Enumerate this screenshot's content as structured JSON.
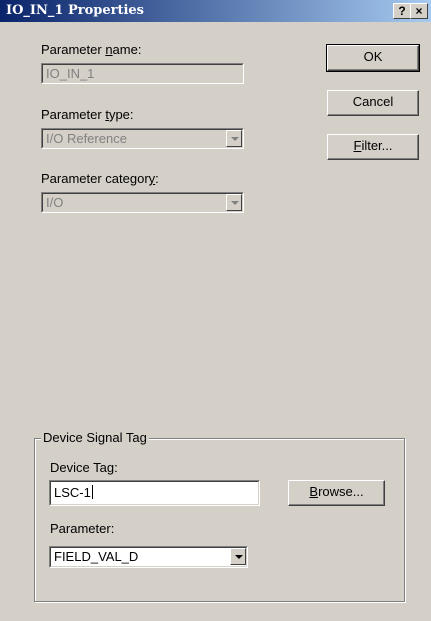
{
  "window": {
    "title": "IO_IN_1 Properties",
    "help_label": "?",
    "close_label": "×"
  },
  "parameter_name": {
    "label_pre": "Parameter ",
    "label_u": "n",
    "label_post": "ame:",
    "value": "IO_IN_1"
  },
  "parameter_type": {
    "label_pre": "Parameter ",
    "label_u": "t",
    "label_post": "ype:",
    "value": "I/O Reference"
  },
  "parameter_category": {
    "label_pre": "Parameter categor",
    "label_u": "y",
    "label_post": ":",
    "value": "I/O"
  },
  "buttons": {
    "ok": "OK",
    "cancel": "Cancel",
    "filter_u": "F",
    "filter_rest": "ilter...",
    "browse_u": "B",
    "browse_rest": "rowse..."
  },
  "device_signal_tag": {
    "group_title": "Device Signal Tag",
    "device_tag_label": "Device Tag:",
    "device_tag_value": "LSC-1",
    "parameter_label": "Parameter:",
    "parameter_value": "FIELD_VAL_D"
  }
}
